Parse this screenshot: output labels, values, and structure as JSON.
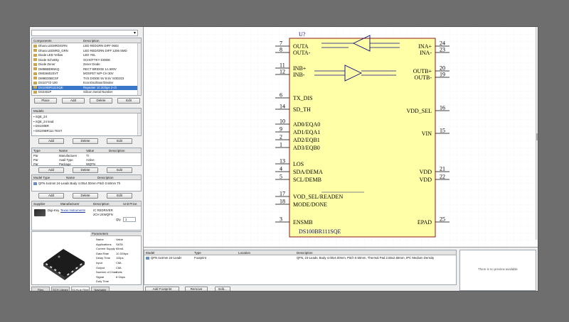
{
  "left_panel": {
    "search_value": "",
    "components_table": {
      "headers": [
        "Components",
        "Description"
      ],
      "rows": [
        {
          "name": "Dhara LED8RD/GRN",
          "desc": "LED REDGRN DIFF 0603"
        },
        {
          "name": "Dhara LED8RD_GRN",
          "desc": "LED RED/GRN DIFF 1206 SMD"
        },
        {
          "name": "Diode LED Yellow",
          "desc": "LED YEL"
        },
        {
          "name": "Diode Schottky",
          "desc": "SCHOTTKY DIODE"
        },
        {
          "name": "Diode Zener",
          "desc": "Zener Diode"
        },
        {
          "name": "DM9BBD9SKQ",
          "desc": "RECT BRIDGE 1A 600V"
        },
        {
          "name": "DMG6602SVT",
          "desc": "MOSFET N/P-CH 30V"
        },
        {
          "name": "DM9D30BCSF",
          "desc": "TVS DIODE 5V 8.5V SOD323"
        },
        {
          "name": "DS1077Z-100",
          "desc": "EconOscillator/Divider"
        },
        {
          "name": "DS100BR111SQE",
          "desc": "Repeater 10.3Gbps 2-ch",
          "selected": true
        },
        {
          "name": "DS2401P",
          "desc": "Silicon Serial Number"
        }
      ],
      "buttons": [
        "Place",
        "Add",
        "Delete",
        "Edit"
      ]
    },
    "models": {
      "header": "Models",
      "items": [
        "SQE_24",
        "SQE_24 lead",
        "DS100BR",
        "DS100BR111 TEST"
      ],
      "buttons": [
        "Add",
        "Delete",
        "Edit"
      ]
    },
    "params": {
      "headers": [
        "Type",
        "Name",
        "Value",
        "Description"
      ],
      "rows": [
        {
          "type": "Par",
          "name": "Manufacturer",
          "value": "TI",
          "desc": ""
        },
        {
          "type": "Par",
          "name": "Avail Type",
          "value": "Active",
          "desc": ""
        },
        {
          "type": "Par",
          "name": "Package",
          "value": "WQFN",
          "desc": ""
        }
      ],
      "buttons": [
        "Add",
        "Delete",
        "Edit"
      ]
    },
    "links": {
      "headers": [
        "Model Type",
        "Name",
        "Description"
      ],
      "row": "QFN 4x4mm 24-Leads Body 4.00x4.00mm Pitch 0.50mm Th",
      "buttons": [
        "Add",
        "Delete",
        "Edit"
      ]
    },
    "suppliers": {
      "headers": [
        "Supplier",
        "Manufacturer",
        "Description",
        "Unit Price"
      ],
      "row_name": "Digi-Key",
      "row_manufacturer": "Texas Instruments",
      "row_desc": "IC REDRIVER 2CH 24WQFN",
      "qty_label": "Qty",
      "qty_value": "1"
    },
    "preview_params": {
      "header": "Parameters",
      "rows": [
        {
          "k": "Name",
          "v": "Value"
        },
        {
          "k": "Applications",
          "v": "SATA"
        },
        {
          "k": "Current Supply",
          "v": "65mA"
        },
        {
          "k": "Data Rate",
          "v": "10.3Gbps"
        },
        {
          "k": "Delay Time",
          "v": "115ps"
        },
        {
          "k": "Input",
          "v": "CML"
        },
        {
          "k": "Output",
          "v": "CML"
        },
        {
          "k": "Number of Channels",
          "v": "2"
        },
        {
          "k": "Signal",
          "v": "8 Gbps"
        },
        {
          "k": "Duty Time",
          "v": ""
        }
      ]
    },
    "tabs": [
      "Files",
      "SCH Library",
      "SCHLib Filter",
      "Navigator"
    ]
  },
  "schematic": {
    "designator": "U?",
    "part_name": "DS100BR111SQE",
    "left_pins": [
      {
        "num": "7",
        "name": "OUTA"
      },
      {
        "num": "8",
        "name": "OUTA-"
      },
      {
        "num": "11",
        "name": "INB+"
      },
      {
        "num": "12",
        "name": "INB-"
      },
      {
        "num": "6",
        "name": "TX_DIS"
      },
      {
        "num": "14",
        "name": "SD_TH"
      },
      {
        "num": "10",
        "name": "AD0/EQA0"
      },
      {
        "num": "9",
        "name": "AD1/EQA1"
      },
      {
        "num": "2",
        "name": "AD2/EQB1"
      },
      {
        "num": "1",
        "name": "AD3/EQB0"
      },
      {
        "num": "13",
        "name": "LOS"
      },
      {
        "num": "4",
        "name": "SDA/DEMA"
      },
      {
        "num": "5",
        "name": "SCL/DEMB"
      },
      {
        "num": "17",
        "name": "VOD_SEL/READEN"
      },
      {
        "num": "18",
        "name": "MODE/DONE"
      },
      {
        "num": "3",
        "name": "ENSMB"
      }
    ],
    "right_pins": [
      {
        "num": "24",
        "name": "INA+"
      },
      {
        "num": "23",
        "name": "INA-"
      },
      {
        "num": "20",
        "name": "OUTB+"
      },
      {
        "num": "19",
        "name": "OUTB-"
      },
      {
        "num": "16",
        "name": "VDD_SEL"
      },
      {
        "num": "15",
        "name": "VIN"
      },
      {
        "num": "21",
        "name": "VDD"
      },
      {
        "num": "22",
        "name": "VDD"
      },
      {
        "num": "25",
        "name": "EPAD"
      }
    ]
  },
  "bottom_panel": {
    "headers": [
      "Model",
      "Type",
      "Location",
      "Description"
    ],
    "row": {
      "model": "QFN 4x4mm 24-Leads",
      "type": "Footprint",
      "location": "",
      "description": "QFN, 24-Leads, Body 4.00x4.00mm, Pitch 0.50mm, Thermal Pad 2.65x2.65mm, IPC Medium Density"
    },
    "buttons": [
      "Add Footprint",
      "Remove",
      "Edit..."
    ],
    "preview_text": "There is no preview available"
  },
  "colors": {
    "body_fill": "#ffffa8",
    "body_stroke": "#8b1a1a",
    "pin_text": "#0a0a80",
    "selection": "#3a76c9"
  }
}
